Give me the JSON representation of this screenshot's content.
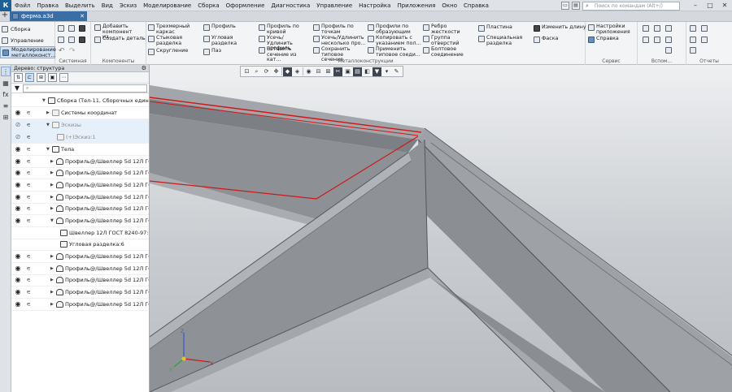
{
  "menu": {
    "logo": "К",
    "items": [
      "Файл",
      "Правка",
      "Выделить",
      "Вид",
      "Эскиз",
      "Моделирование",
      "Сборка",
      "Оформление",
      "Диагностика",
      "Управление",
      "Настройка",
      "Приложения",
      "Окно",
      "Справка"
    ],
    "search_placeholder": "Поиск по командам (Alt+/)"
  },
  "tabs": {
    "document": "ферма.a3d"
  },
  "ribbon": {
    "modes": [
      "Сборка",
      "Управление",
      "Моделирование металлоконст..."
    ],
    "system": {
      "label": "Системная"
    },
    "components": {
      "label": "Компоненты",
      "add": "Добавить компонент из...",
      "create": "Создать деталь"
    },
    "metal": {
      "label": "Металлоконструкции",
      "b1": "Трехмерный каркас",
      "b2": "Стыковая разделка",
      "b3": "Скругление",
      "b4": "Профиль",
      "b5": "Угловая разделка",
      "b6": "Паз",
      "b7": "Профиль по кривой",
      "b8": "Усечь/Удлинить профиль",
      "b9": "Вставить сечение из кат...",
      "b10": "Профиль по точкам",
      "b11": "Усечь/Удлинить несколько про...",
      "b12": "Сохранить типовое сечение",
      "b13": "Профили по образующим",
      "b14": "Копировать с указанием пол...",
      "b15": "Применить типовое соеди...",
      "b16": "Ребро жесткости",
      "b17": "Группа отверстий",
      "b18": "Болтовое соединение",
      "b19": "Пластина",
      "b20": "Специальная разделка",
      "b21": "Изменить длину",
      "b22": "Фаска"
    },
    "service": {
      "label": "Сервис",
      "settings": "Настройки приложения",
      "help": "Справка"
    },
    "aux": {
      "label": "Вспом..."
    },
    "reports": {
      "label": "Отчеты"
    }
  },
  "tree": {
    "title": "Дерево: структура",
    "filter_placeholder": "",
    "rows": [
      {
        "text": "Сборка (Тел-11, Сборочных единиц..."
      },
      {
        "text": "Системы координат"
      },
      {
        "text": "Эскизы"
      },
      {
        "text": "(+)Эскиз:1"
      },
      {
        "text": "Тела"
      },
      {
        "text": "Профиль@/Швеллер 5d 12Л ГОС"
      },
      {
        "text": "Профиль@/Швеллер 5d 12Л ГОС"
      },
      {
        "text": "Профиль@/Швеллер 5d 12Л ГОС"
      },
      {
        "text": "Профиль@/Швеллер 5d 12Л ГОС"
      },
      {
        "text": "Профиль@/Швеллер 5d 12Л ГОС"
      },
      {
        "text": "Профиль@/Швеллер 5d 12Л ГОС"
      },
      {
        "text": "Швеллер  12Л ГОСТ 8240-97:6"
      },
      {
        "text": "Угловая разделка:6"
      },
      {
        "text": "Профиль@/Швеллер 5d 12Л ГОС"
      },
      {
        "text": "Профиль@/Швеллер 5d 12Л ГОС"
      },
      {
        "text": "Профиль@/Швеллер 5d 12Л ГОС"
      },
      {
        "text": "Профиль@/Швеллер 5d 12Л ГОС"
      },
      {
        "text": "Профиль@/Швеллер 5d 12Л ГОС"
      }
    ]
  },
  "axes": {
    "x": "X",
    "y": "Y",
    "z": "Z"
  },
  "colors": {
    "accent": "#3a6fa5",
    "edge_highlight": "#d01818",
    "beam": "#8f9296"
  }
}
